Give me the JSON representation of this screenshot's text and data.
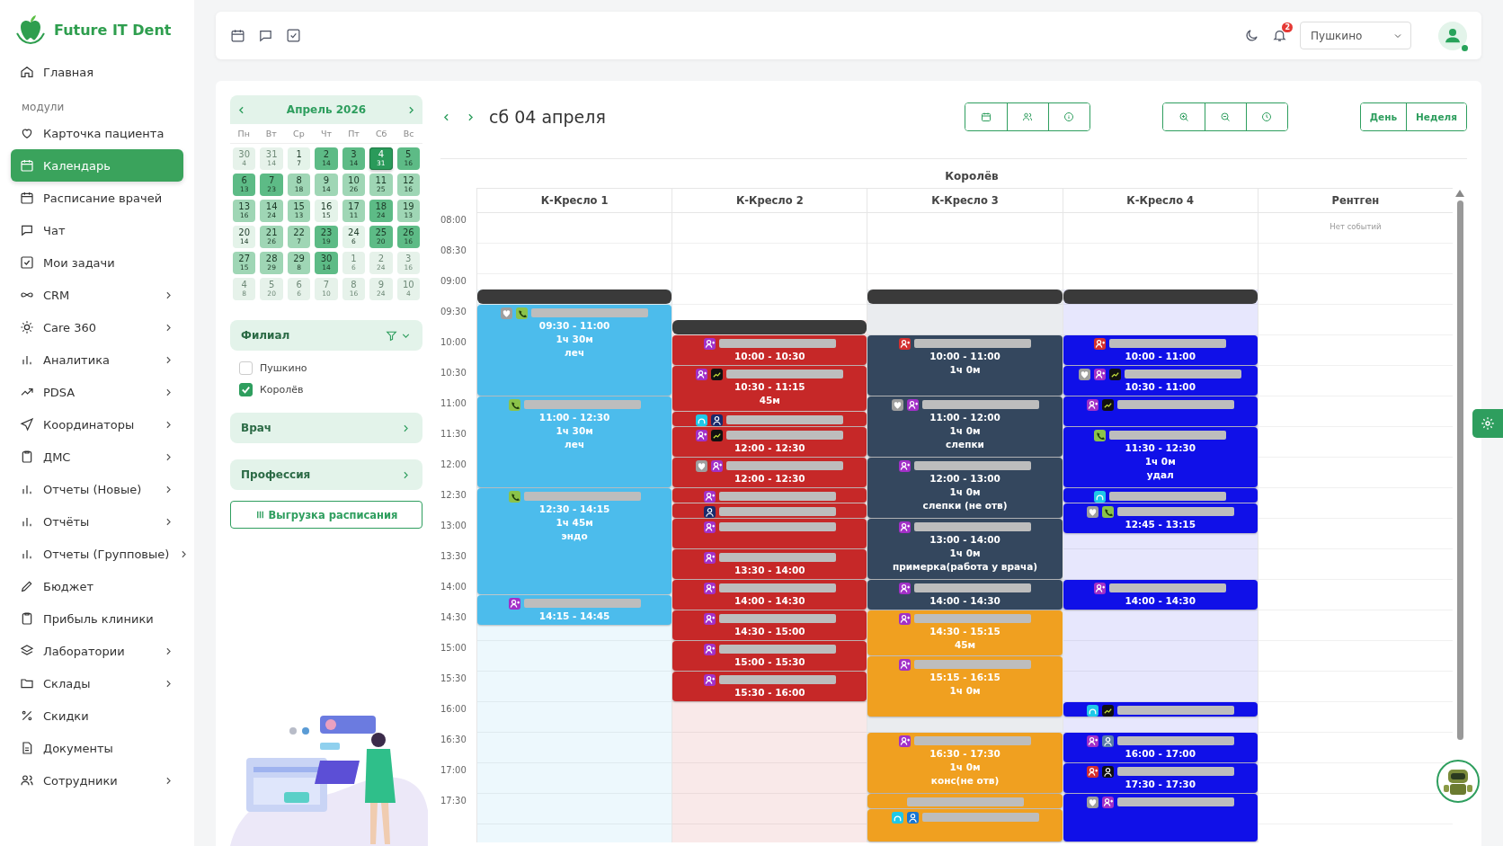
{
  "app": {
    "name": "Future IT Dent"
  },
  "sidebar": {
    "home": {
      "label": "Главная",
      "selected": false
    },
    "section_title": "модули",
    "items": [
      {
        "label": "Карточка пациента",
        "selected": false,
        "expandable": false
      },
      {
        "label": "Календарь",
        "selected": true,
        "expandable": false
      },
      {
        "label": "Расписание врачей",
        "selected": false,
        "expandable": false
      },
      {
        "label": "Чат",
        "selected": false,
        "expandable": false
      },
      {
        "label": "Мои задачи",
        "selected": false,
        "expandable": false
      },
      {
        "label": "CRM",
        "selected": false,
        "expandable": true
      },
      {
        "label": "Care 360",
        "selected": false,
        "expandable": true
      },
      {
        "label": "Аналитика",
        "selected": false,
        "expandable": true
      },
      {
        "label": "PDSA",
        "selected": false,
        "expandable": true
      },
      {
        "label": "Координаторы",
        "selected": false,
        "expandable": true
      },
      {
        "label": "ДМС",
        "selected": false,
        "expandable": true
      },
      {
        "label": "Отчеты (Новые)",
        "selected": false,
        "expandable": true
      },
      {
        "label": "Отчёты",
        "selected": false,
        "expandable": true
      },
      {
        "label": "Отчеты (Групповые)",
        "selected": false,
        "expandable": true
      },
      {
        "label": "Бюджет",
        "selected": false,
        "expandable": false
      },
      {
        "label": "Прибыль клиники",
        "selected": false,
        "expandable": false
      },
      {
        "label": "Лаборатории",
        "selected": false,
        "expandable": true
      },
      {
        "label": "Склады",
        "selected": false,
        "expandable": true
      },
      {
        "label": "Скидки",
        "selected": false,
        "expandable": false
      },
      {
        "label": "Документы",
        "selected": false,
        "expandable": false
      },
      {
        "label": "Сотрудники",
        "selected": false,
        "expandable": true
      }
    ]
  },
  "header": {
    "notifications": "2",
    "branch_select": "Пушкино",
    "online": true
  },
  "mini_calendar": {
    "title": "Апрель 2026",
    "weekdays": [
      "Пн",
      "Вт",
      "Ср",
      "Чт",
      "Пт",
      "Сб",
      "Вс"
    ],
    "weeks": [
      [
        {
          "day": "30",
          "count": "4",
          "kind": "out",
          "selected": false
        },
        {
          "day": "31",
          "count": "14",
          "kind": "out",
          "selected": false
        },
        {
          "day": "1",
          "count": "7",
          "kind": "light",
          "selected": false
        },
        {
          "day": "2",
          "count": "14",
          "kind": "dark",
          "selected": false
        },
        {
          "day": "3",
          "count": "14",
          "kind": "dark",
          "selected": false
        },
        {
          "day": "4",
          "count": "31",
          "kind": "dark",
          "selected": true
        },
        {
          "day": "5",
          "count": "16",
          "kind": "dark",
          "selected": false
        }
      ],
      [
        {
          "day": "6",
          "count": "13",
          "kind": "dark",
          "selected": false
        },
        {
          "day": "7",
          "count": "23",
          "kind": "dark",
          "selected": false
        },
        {
          "day": "8",
          "count": "18",
          "kind": "medium",
          "selected": false
        },
        {
          "day": "9",
          "count": "14",
          "kind": "medium",
          "selected": false
        },
        {
          "day": "10",
          "count": "26",
          "kind": "medium",
          "selected": false
        },
        {
          "day": "11",
          "count": "25",
          "kind": "medium",
          "selected": false
        },
        {
          "day": "12",
          "count": "16",
          "kind": "medium",
          "selected": false
        }
      ],
      [
        {
          "day": "13",
          "count": "16",
          "kind": "medium",
          "selected": false
        },
        {
          "day": "14",
          "count": "24",
          "kind": "medium",
          "selected": false
        },
        {
          "day": "15",
          "count": "13",
          "kind": "medium",
          "selected": false
        },
        {
          "day": "16",
          "count": "15",
          "kind": "light",
          "selected": false
        },
        {
          "day": "17",
          "count": "11",
          "kind": "medium",
          "selected": false
        },
        {
          "day": "18",
          "count": "24",
          "kind": "dark",
          "selected": false
        },
        {
          "day": "19",
          "count": "13",
          "kind": "medium",
          "selected": false
        }
      ],
      [
        {
          "day": "20",
          "count": "14",
          "kind": "light",
          "selected": false
        },
        {
          "day": "21",
          "count": "26",
          "kind": "medium",
          "selected": false
        },
        {
          "day": "22",
          "count": "7",
          "kind": "medium",
          "selected": false
        },
        {
          "day": "23",
          "count": "19",
          "kind": "dark",
          "selected": false
        },
        {
          "day": "24",
          "count": "6",
          "kind": "light",
          "selected": false
        },
        {
          "day": "25",
          "count": "20",
          "kind": "dark",
          "selected": false
        },
        {
          "day": "26",
          "count": "16",
          "kind": "dark",
          "selected": false
        }
      ],
      [
        {
          "day": "27",
          "count": "15",
          "kind": "medium",
          "selected": false
        },
        {
          "day": "28",
          "count": "29",
          "kind": "medium",
          "selected": false
        },
        {
          "day": "29",
          "count": "8",
          "kind": "medium",
          "selected": false
        },
        {
          "day": "30",
          "count": "14",
          "kind": "dark",
          "selected": false
        },
        {
          "day": "1",
          "count": "6",
          "kind": "out",
          "selected": false
        },
        {
          "day": "2",
          "count": "24",
          "kind": "out",
          "selected": false
        },
        {
          "day": "3",
          "count": "16",
          "kind": "out",
          "selected": false
        }
      ],
      [
        {
          "day": "4",
          "count": "8",
          "kind": "out",
          "selected": false
        },
        {
          "day": "5",
          "count": "20",
          "kind": "out",
          "selected": false
        },
        {
          "day": "6",
          "count": "6",
          "kind": "out",
          "selected": false
        },
        {
          "day": "7",
          "count": "10",
          "kind": "out",
          "selected": false
        },
        {
          "day": "8",
          "count": "16",
          "kind": "out",
          "selected": false
        },
        {
          "day": "9",
          "count": "24",
          "kind": "out",
          "selected": false
        },
        {
          "day": "10",
          "count": "4",
          "kind": "out",
          "selected": false
        }
      ]
    ]
  },
  "filters": {
    "branch": {
      "label": "Филиал",
      "options": [
        {
          "label": "Пушкино",
          "checked": false
        },
        {
          "label": "Королёв",
          "checked": true
        }
      ]
    },
    "doctor": {
      "label": "Врач"
    },
    "profession": {
      "label": "Профессия"
    },
    "export_button": "Выгрузка расписания"
  },
  "schedule": {
    "date_title": "сб 04 апреля",
    "views": [
      "День",
      "Неделя"
    ],
    "group": "Королёв",
    "times": [
      "08:00",
      "08:30",
      "09:00",
      "09:30",
      "10:00",
      "10:30",
      "11:00",
      "11:30",
      "12:00",
      "12:30",
      "13:00",
      "13:30",
      "14:00",
      "14:30",
      "15:00",
      "15:30",
      "16:00",
      "16:30",
      "17:00",
      "17:30"
    ],
    "columns": [
      {
        "name": "К-Кресло 1",
        "items": [
          {
            "kind": "hourquarter"
          },
          {
            "kind": "quarter",
            "break": true
          },
          {
            "kind": "hourhalf",
            "color": "#4cbcec",
            "badges": [
              {
                "kind": "heart",
                "color": "#9e9e9e"
              },
              {
                "kind": "phone",
                "color": "#8bc34a"
              }
            ],
            "lines": [
              "09:30 - 11:00",
              "1ч 30м",
              "леч"
            ]
          },
          {
            "kind": "hourhalf",
            "color": "#4cbcec",
            "badges": [
              {
                "kind": "phone",
                "color": "#8bc34a"
              }
            ],
            "lines": [
              "11:00 - 12:30",
              "1ч 30м",
              "леч"
            ]
          },
          {
            "kind": "hourthreequarters",
            "color": "#4cbcec",
            "badges": [
              {
                "kind": "phone",
                "color": "#8bc34a"
              }
            ],
            "lines": [
              "12:30 - 14:15",
              "1ч 45м",
              "эндо"
            ]
          },
          {
            "kind": "half",
            "color": "#4cbcec",
            "badges": [
              {
                "kind": "user-plus",
                "color": "#a230c8"
              }
            ],
            "lines": [
              "14:15 - 14:45"
            ]
          }
        ]
      },
      {
        "name": "К-Кресло 2",
        "items": [
          {
            "kind": "hourthreequarters"
          },
          {
            "kind": "quarter",
            "break": true
          },
          {
            "kind": "half",
            "color": "#c62828",
            "badges": [
              {
                "kind": "user-plus",
                "color": "#a230c8"
              }
            ],
            "lines": [
              "10:00 - 10:30"
            ]
          },
          {
            "kind": "threequarters",
            "color": "#c62828",
            "badges": [
              {
                "kind": "user-plus",
                "color": "#a230c8"
              },
              {
                "kind": "chart",
                "color": "#111111"
              }
            ],
            "lines": [
              "10:30 - 11:15",
              "45м"
            ]
          },
          {
            "kind": "quarter",
            "color": "#c62828",
            "badges": [
              {
                "kind": "headset",
                "color": "#1ec8e8"
              },
              {
                "kind": "person",
                "color": "#1a2a6c"
              }
            ]
          },
          {
            "kind": "half",
            "color": "#c62828",
            "badges": [
              {
                "kind": "user-plus",
                "color": "#a230c8"
              },
              {
                "kind": "chart",
                "color": "#111111"
              }
            ],
            "lines": [
              "12:00 - 12:30"
            ]
          },
          {
            "kind": "half",
            "color": "#c62828",
            "badges": [
              {
                "kind": "heart",
                "color": "#9e9e9e"
              },
              {
                "kind": "user-plus",
                "color": "#a230c8"
              }
            ],
            "lines": [
              "12:00 - 12:30"
            ]
          },
          {
            "kind": "quarter",
            "color": "#c62828",
            "badges": [
              {
                "kind": "user-plus",
                "color": "#a230c8"
              }
            ]
          },
          {
            "kind": "quarter",
            "color": "#c62828",
            "badges": [
              {
                "kind": "person",
                "color": "#1a2a6c"
              }
            ]
          },
          {
            "kind": "half",
            "color": "#c62828",
            "badges": [
              {
                "kind": "user-plus",
                "color": "#a230c8"
              }
            ]
          },
          {
            "kind": "half",
            "color": "#c62828",
            "badges": [
              {
                "kind": "user-plus",
                "color": "#a230c8"
              }
            ],
            "lines": [
              "13:30 - 14:00"
            ]
          },
          {
            "kind": "half",
            "color": "#c62828",
            "badges": [
              {
                "kind": "user-plus",
                "color": "#a230c8"
              }
            ],
            "lines": [
              "14:00 - 14:30"
            ]
          },
          {
            "kind": "half",
            "color": "#c62828",
            "badges": [
              {
                "kind": "user-plus",
                "color": "#a230c8"
              }
            ],
            "lines": [
              "14:30 - 15:00"
            ]
          },
          {
            "kind": "half",
            "color": "#c62828",
            "badges": [
              {
                "kind": "user-plus",
                "color": "#a230c8"
              }
            ],
            "lines": [
              "15:00 - 15:30"
            ]
          },
          {
            "kind": "half",
            "color": "#c62828",
            "badges": [
              {
                "kind": "user-plus",
                "color": "#a230c8"
              }
            ],
            "lines": [
              "15:30 - 16:00"
            ]
          }
        ]
      },
      {
        "name": "К-Кресло 3",
        "items": [
          {
            "kind": "hourquarter"
          },
          {
            "kind": "quarter",
            "break": true
          },
          {
            "kind": "half"
          },
          {
            "kind": "hour",
            "color": "#34475e",
            "badges": [
              {
                "kind": "user-plus",
                "color": "#d32f2f"
              }
            ],
            "lines": [
              "10:00 - 11:00",
              "1ч 0м"
            ]
          },
          {
            "kind": "hour",
            "color": "#34475e",
            "badges": [
              {
                "kind": "heart",
                "color": "#9e9e9e"
              },
              {
                "kind": "user-plus",
                "color": "#a230c8"
              }
            ],
            "lines": [
              "11:00 - 12:00",
              "1ч 0м",
              "слепки"
            ]
          },
          {
            "kind": "hour",
            "color": "#34475e",
            "badges": [
              {
                "kind": "user-plus",
                "color": "#a230c8"
              }
            ],
            "lines": [
              "12:00 - 13:00",
              "1ч 0м",
              "слепки (не отв)"
            ]
          },
          {
            "kind": "hour",
            "color": "#34475e",
            "badges": [
              {
                "kind": "user-plus",
                "color": "#a230c8"
              }
            ],
            "lines": [
              "13:00 - 14:00",
              "1ч 0м",
              "примерка(работа у врача)"
            ]
          },
          {
            "kind": "half",
            "color": "#34475e",
            "badges": [
              {
                "kind": "user-plus",
                "color": "#a230c8"
              }
            ],
            "lines": [
              "14:00 - 14:30"
            ]
          },
          {
            "kind": "threequarters",
            "color": "#f0a020",
            "badges": [
              {
                "kind": "user-plus",
                "color": "#a230c8"
              }
            ],
            "lines": [
              "14:30 - 15:15",
              "45м"
            ]
          },
          {
            "kind": "hour",
            "color": "#f0a020",
            "badges": [
              {
                "kind": "user-plus",
                "color": "#a230c8"
              }
            ],
            "lines": [
              "15:15 - 16:15",
              "1ч 0м"
            ]
          },
          {
            "kind": "quarter"
          },
          {
            "kind": "hour",
            "color": "#f0a020",
            "badges": [
              {
                "kind": "user-plus",
                "color": "#a230c8"
              }
            ],
            "lines": [
              "16:30 - 17:30",
              "1ч 0м",
              "конс(не отв)"
            ]
          },
          {
            "kind": "quarter",
            "color": "#f0a020"
          },
          {
            "kind": "open",
            "color": "#f0a020",
            "badges": [
              {
                "kind": "headset",
                "color": "#1ec8e8"
              },
              {
                "kind": "person",
                "color": "#1976d2"
              }
            ]
          }
        ]
      },
      {
        "name": "К-Кресло 4",
        "items": [
          {
            "kind": "hourquarter"
          },
          {
            "kind": "quarter",
            "break": true
          },
          {
            "kind": "half"
          },
          {
            "kind": "half",
            "color": "#1010e8",
            "badges": [
              {
                "kind": "user-plus",
                "color": "#d32f2f"
              }
            ],
            "lines": [
              "10:00 - 11:00"
            ]
          },
          {
            "kind": "half",
            "color": "#1010e8",
            "badges": [
              {
                "kind": "heart",
                "color": "#9e9e9e"
              },
              {
                "kind": "user-plus",
                "color": "#a230c8"
              },
              {
                "kind": "chart",
                "color": "#111111"
              }
            ],
            "lines": [
              "10:30 - 11:00"
            ]
          },
          {
            "kind": "half",
            "color": "#1010e8",
            "badges": [
              {
                "kind": "user-plus",
                "color": "#a230c8"
              },
              {
                "kind": "chart",
                "color": "#111111"
              }
            ]
          },
          {
            "kind": "hour",
            "color": "#1010e8",
            "badges": [
              {
                "kind": "phone",
                "color": "#8bc34a"
              }
            ],
            "lines": [
              "11:30 - 12:30",
              "1ч 0м",
              "удал"
            ]
          },
          {
            "kind": "quarter",
            "color": "#1010e8",
            "badges": [
              {
                "kind": "headset",
                "color": "#1ec8e8"
              }
            ]
          },
          {
            "kind": "half",
            "color": "#1010e8",
            "badges": [
              {
                "kind": "heart",
                "color": "#9e9e9e"
              },
              {
                "kind": "phone",
                "color": "#8bc34a"
              }
            ],
            "lines": [
              "12:45 - 13:15"
            ]
          },
          {
            "kind": "threequarters"
          },
          {
            "kind": "half",
            "color": "#1010e8",
            "badges": [
              {
                "kind": "user-plus",
                "color": "#a230c8"
              }
            ],
            "lines": [
              "14:00 - 14:30"
            ]
          },
          {
            "kind": "hourhalf"
          },
          {
            "kind": "quarter",
            "color": "#1010e8",
            "badges": [
              {
                "kind": "headset",
                "color": "#1ec8e8"
              },
              {
                "kind": "chart",
                "color": "#111111"
              }
            ]
          },
          {
            "kind": "quarter"
          },
          {
            "kind": "half",
            "color": "#1010e8",
            "badges": [
              {
                "kind": "user-plus",
                "color": "#a230c8"
              },
              {
                "kind": "person",
                "color": "#5a7fa8"
              }
            ],
            "lines": [
              "16:00 - 17:00"
            ]
          },
          {
            "kind": "half",
            "color": "#1010e8",
            "badges": [
              {
                "kind": "user-plus",
                "color": "#d32f2f"
              },
              {
                "kind": "person",
                "color": "#111111"
              }
            ],
            "lines": [
              "17:30 - 17:30"
            ]
          },
          {
            "kind": "open",
            "color": "#1010e8",
            "badges": [
              {
                "kind": "heart",
                "color": "#9e9e9e"
              },
              {
                "kind": "user-plus",
                "color": "#a230c8"
              }
            ]
          }
        ]
      },
      {
        "name": "Рентген",
        "empty_text": "Нет событий"
      }
    ]
  }
}
